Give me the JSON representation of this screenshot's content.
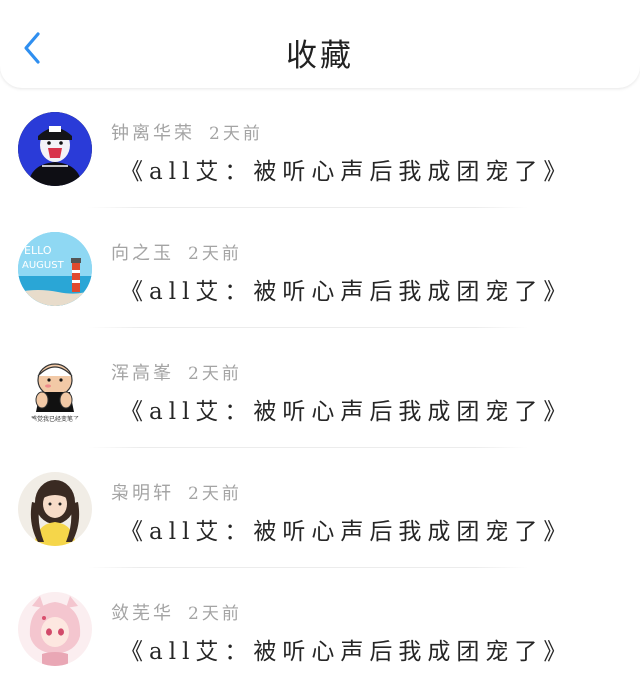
{
  "header": {
    "title": "收藏",
    "back_icon": "chevron-left-icon",
    "accent_color": "#2f8ff0"
  },
  "items": [
    {
      "name": "钟离华荣",
      "time": "2天前",
      "title": "《all艾：被听心声后我成团宠了》",
      "avatar": "avatar-illustrated-boy-cap"
    },
    {
      "name": "向之玉",
      "time": "2天前",
      "title": "《all艾：被听心声后我成团宠了》",
      "avatar": "avatar-hello-august-lighthouse"
    },
    {
      "name": "浑高峯",
      "time": "2天前",
      "title": "《all艾：被听心声后我成团宠了》",
      "avatar": "avatar-cartoon-sticker"
    },
    {
      "name": "枭明轩",
      "time": "2天前",
      "title": "《all艾：被听心声后我成团宠了》",
      "avatar": "avatar-girl-photo"
    },
    {
      "name": "敛芜华",
      "time": "2天前",
      "title": "《all艾：被听心声后我成团宠了》",
      "avatar": "avatar-anime-pink-hair"
    }
  ],
  "sticker_caption": "感觉我已经变笔了"
}
